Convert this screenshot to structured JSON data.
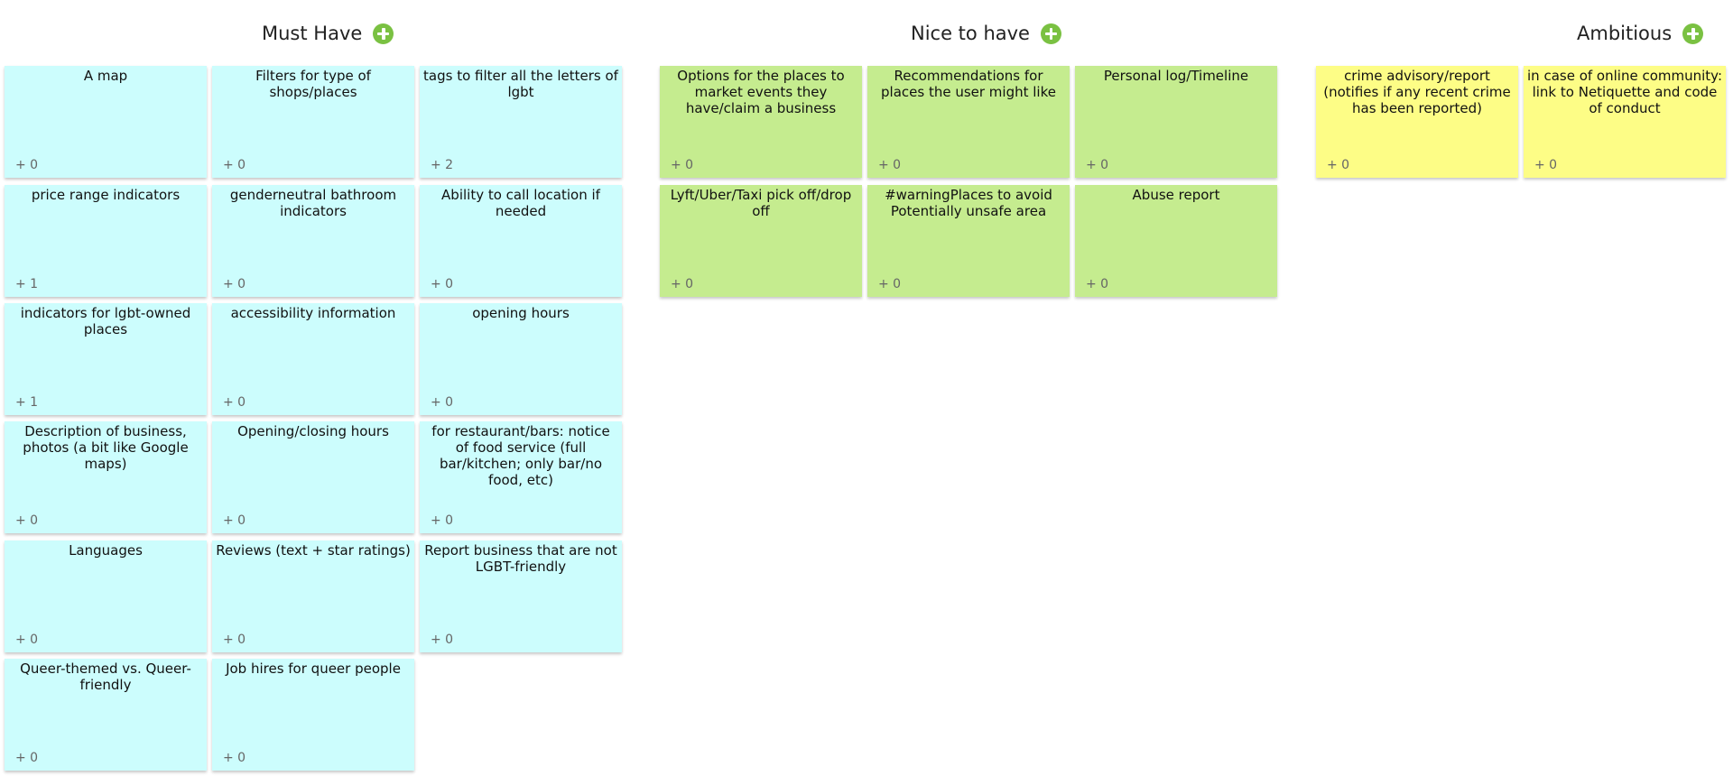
{
  "colors": {
    "cyan": "#ccfdfd",
    "green": "#c5ec8f",
    "yellow": "#fdfd86",
    "add_button": "#7ac142"
  },
  "columns": [
    {
      "title": "Must Have",
      "add_icon": "plus-circle-icon",
      "cards": [
        {
          "text": "A map",
          "votes": "+ 0"
        },
        {
          "text": "Filters for type of shops/places",
          "votes": "+ 0"
        },
        {
          "text": "tags to filter all the letters of lgbt",
          "votes": "+ 2"
        },
        {
          "text": "price range indicators",
          "votes": "+ 1"
        },
        {
          "text": "genderneutral bathroom indicators",
          "votes": "+ 0"
        },
        {
          "text": "Ability to call location if needed",
          "votes": "+ 0"
        },
        {
          "text": "indicators for lgbt-owned places",
          "votes": "+ 1"
        },
        {
          "text": "accessibility information",
          "votes": "+ 0"
        },
        {
          "text": "opening hours",
          "votes": "+ 0"
        },
        {
          "text": "Description of business, photos (a bit like Google maps)",
          "votes": "+ 0"
        },
        {
          "text": "Opening/closing hours",
          "votes": "+ 0"
        },
        {
          "text": "for restaurant/bars: notice of food service (full bar/kitchen; only bar/no food, etc)",
          "votes": "+ 0"
        },
        {
          "text": "Languages",
          "votes": "+ 0"
        },
        {
          "text": "Reviews (text + star ratings)",
          "votes": "+ 0"
        },
        {
          "text": "Report business that are not LGBT-friendly",
          "votes": "+ 0"
        },
        {
          "text": "Queer-themed vs. Queer-friendly",
          "votes": "+ 0"
        },
        {
          "text": "Job hires for queer people",
          "votes": "+ 0"
        }
      ]
    },
    {
      "title": "Nice to have",
      "add_icon": "plus-circle-icon",
      "cards": [
        {
          "text": "Options for the places to market events they have/claim a business",
          "votes": "+ 0"
        },
        {
          "text": "Recommendations for places the user might like",
          "votes": "+ 0"
        },
        {
          "text": "Personal log/Timeline",
          "votes": "+ 0"
        },
        {
          "text": "Lyft/Uber/Taxi pick off/drop off",
          "votes": "+ 0"
        },
        {
          "text": "#warningPlaces to avoid Potentially unsafe area",
          "votes": "+ 0"
        },
        {
          "text": "Abuse report",
          "votes": "+ 0"
        }
      ]
    },
    {
      "title": "Ambitious",
      "add_icon": "plus-circle-icon",
      "cards": [
        {
          "text": "crime advisory/report (notifies if any recent crime has been reported)",
          "votes": "+ 0"
        },
        {
          "text": "in case of online community: link to Netiquette and code of conduct",
          "votes": "+ 0"
        }
      ]
    }
  ]
}
